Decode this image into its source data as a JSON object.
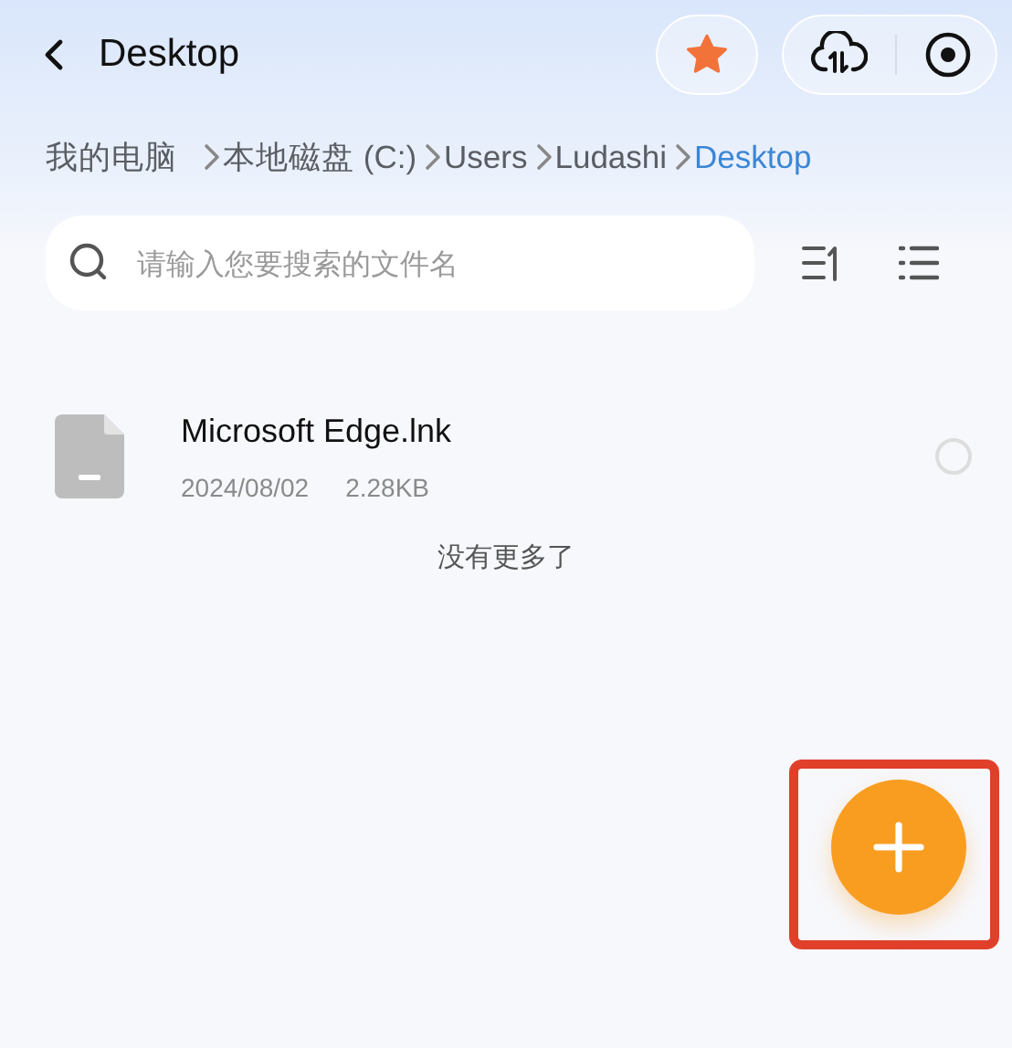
{
  "header": {
    "title": "Desktop",
    "favorite": true
  },
  "breadcrumb": [
    {
      "label": "我的电脑",
      "current": false
    },
    {
      "label": "本地磁盘 (C:)",
      "current": false
    },
    {
      "label": "Users",
      "current": false
    },
    {
      "label": "Ludashi",
      "current": false
    },
    {
      "label": "Desktop",
      "current": true
    }
  ],
  "search": {
    "placeholder": "请输入您要搜索的文件名"
  },
  "files": [
    {
      "name": "Microsoft Edge.lnk",
      "date": "2024/08/02",
      "size": "2.28KB",
      "selected": false
    }
  ],
  "end_note": "没有更多了",
  "fab": {
    "highlighted": true
  }
}
